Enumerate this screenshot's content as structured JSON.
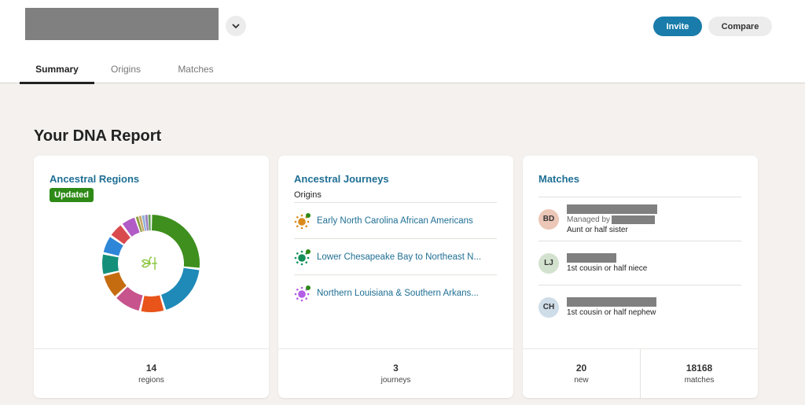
{
  "header": {
    "name_redacted": true,
    "dropdown_icon": "chevron-down-icon",
    "invite_label": "Invite",
    "compare_label": "Compare"
  },
  "tabs": [
    {
      "label": "Summary",
      "active": true
    },
    {
      "label": "Origins",
      "active": false
    },
    {
      "label": "Matches",
      "active": false
    }
  ],
  "page_title": "Your DNA Report",
  "ancestral_regions": {
    "title": "Ancestral Regions",
    "badge": "Updated",
    "center_icon": "ancestry-leaf-icon",
    "segment_colors": [
      "#3e8f1d",
      "#1f8ab8",
      "#e8541a",
      "#c7548c",
      "#c66c10",
      "#14907a",
      "#2e86d8",
      "#d94a4f",
      "#b15cc6",
      "#8a9a3a",
      "#c9a86a",
      "#8fb0d8",
      "#9a7fc0",
      "#6aa05a"
    ],
    "segment_shares": [
      26,
      18,
      8,
      9,
      8,
      7,
      6,
      5,
      5,
      1,
      1,
      1,
      1,
      1
    ],
    "count": "14",
    "count_label": "regions"
  },
  "ancestral_journeys": {
    "title": "Ancestral Journeys",
    "subtitle": "Origins",
    "items": [
      {
        "label": "Early North Carolina African Americans",
        "color": "#d98a1a"
      },
      {
        "label": "Lower Chesapeake Bay to Northeast N...",
        "color": "#13905a"
      },
      {
        "label": "Northern Louisiana & Southern Arkans...",
        "color": "#b45de6"
      }
    ],
    "new_dot_color": "#2e8a17",
    "count": "3",
    "count_label": "journeys"
  },
  "matches": {
    "title": "Matches",
    "items": [
      {
        "initials": "BD",
        "avatar_color": "#ecc6b6",
        "managed_label": "Managed by",
        "relationship": "Aunt or half sister"
      },
      {
        "initials": "LJ",
        "avatar_color": "#d3e2cf",
        "managed_label": "",
        "relationship": "1st cousin or half niece"
      },
      {
        "initials": "CH",
        "avatar_color": "#cfdde9",
        "managed_label": "",
        "relationship": "1st cousin or half nephew"
      }
    ],
    "new_count": "20",
    "new_label": "new",
    "total_count": "18168",
    "total_label": "matches"
  }
}
